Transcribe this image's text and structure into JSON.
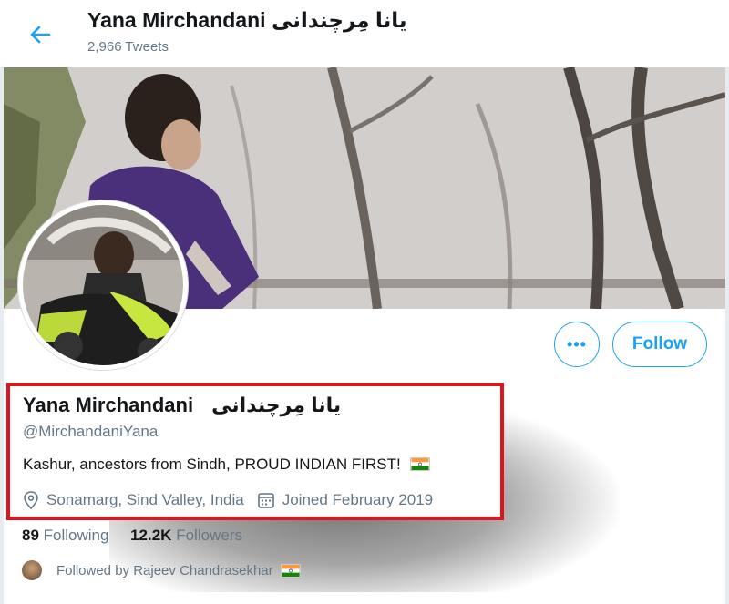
{
  "header": {
    "title": "Yana Mirchandani یانا مِرچندانی",
    "tweet_count": "2,966 Tweets"
  },
  "actions": {
    "more_label": "•••",
    "follow_label": "Follow"
  },
  "profile": {
    "name": "Yana Mirchandani",
    "name_urdu": "یانا مِرچندانی",
    "handle": "@MirchandaniYana",
    "bio": "Kashur, ancestors from Sindh, PROUD INDIAN FIRST!",
    "location": "Sonamarg, Sind Valley, India",
    "joined": "Joined February 2019"
  },
  "stats": {
    "following_count": "89",
    "following_label": "Following",
    "followers_count": "12.2K",
    "followers_label": "Followers"
  },
  "followed_by": "Followed by Rajeev Chandrasekhar",
  "colors": {
    "accent": "#1da1f2",
    "highlight_border": "#e0141e",
    "muted_text": "#657786"
  },
  "icons": [
    "back-arrow-icon",
    "location-icon",
    "calendar-icon",
    "india-flag-icon",
    "more-icon"
  ]
}
